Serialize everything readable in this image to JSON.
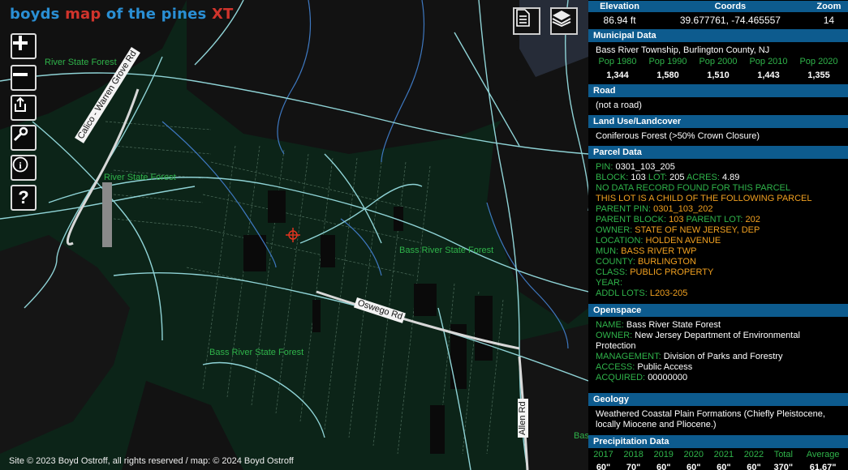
{
  "brand": {
    "part1": "boyds ",
    "part2": "map",
    "part3": " of the pines ",
    "part4": "XT"
  },
  "map": {
    "labels": [
      "River State Forest",
      "River State Forest",
      "Bass River State Forest",
      "Bass River State Forest",
      "Bas"
    ],
    "roads": {
      "calico": "Calico - Warren Grove Rd",
      "oswego": "Oswego Rd",
      "allen": "Allen Rd"
    },
    "controls": [
      "zoom-in-icon",
      "zoom-out-icon",
      "share-icon",
      "wrench-icon",
      "info-icon",
      "help-icon"
    ],
    "help_glyph": "?",
    "info_glyph": "i",
    "top_buttons": [
      "document-icon",
      "layers-icon"
    ]
  },
  "footer": {
    "text": "Site © 2023 Boyd Ostroff, all rights reserved / map: © 2024 Boyd Ostroff"
  },
  "panel": {
    "top": {
      "headers": [
        "Elevation",
        "Coords",
        "Zoom"
      ],
      "values": [
        "86.94 ft",
        "39.677761, -74.465557",
        "14"
      ]
    },
    "municipal": {
      "title": "Municipal Data",
      "place": "Bass River Township, Burlington County, NJ",
      "pop_headers": [
        "Pop 1980",
        "Pop 1990",
        "Pop 2000",
        "Pop 2010",
        "Pop 2020"
      ],
      "pop_values": [
        "1,344",
        "1,580",
        "1,510",
        "1,443",
        "1,355"
      ]
    },
    "road": {
      "title": "Road",
      "value": "(not a road)"
    },
    "landuse": {
      "title": "Land Use/Landcover",
      "value": "Coniferous Forest (>50% Crown Closure)"
    },
    "parcel": {
      "title": "Parcel Data",
      "pin_label": "PIN:",
      "pin": "0301_103_205",
      "block_label": "BLOCK:",
      "block": "103",
      "lot_label": "LOT:",
      "lot": "205",
      "acres_label": "ACRES:",
      "acres": "4.89",
      "no_record": "NO DATA RECORD FOUND FOR THIS PARCEL",
      "child": "THIS LOT IS A CHILD OF THE FOLLOWING PARCEL",
      "parent_pin_label": "PARENT PIN:",
      "parent_pin": "0301_103_202",
      "parent_block_label": "PARENT BLOCK:",
      "parent_block": "103",
      "parent_lot_label": "PARENT LOT:",
      "parent_lot": "202",
      "owner_label": "OWNER:",
      "owner": "STATE OF NEW JERSEY, DEP",
      "location_label": "LOCATION:",
      "location": "HOLDEN AVENUE",
      "mun_label": "MUN:",
      "mun": "BASS RIVER TWP",
      "county_label": "COUNTY:",
      "county": "BURLINGTON",
      "class_label": "CLASS:",
      "class": "PUBLIC PROPERTY",
      "year_label": "YEAR:",
      "addl_label": "ADDL LOTS:",
      "addl": "L203-205"
    },
    "openspace": {
      "title": "Openspace",
      "name_label": "NAME:",
      "name": "Bass River State Forest",
      "owner_label": "OWNER:",
      "owner": "New Jersey Department of Environmental Protection",
      "mgmt_label": "MANAGEMENT:",
      "mgmt": "Division of Parks and Forestry",
      "access_label": "ACCESS:",
      "access": "Public Access",
      "acquired_label": "ACQUIRED:",
      "acquired": "00000000"
    },
    "geology": {
      "title": "Geology",
      "value": "Weathered Coastal Plain Formations (Chiefly Pleistocene, locally Miocene and Pliocene.)"
    },
    "precip": {
      "title": "Precipitation Data",
      "headers": [
        "2017",
        "2018",
        "2019",
        "2020",
        "2021",
        "2022",
        "Total",
        "Average"
      ],
      "values": [
        "60\"",
        "70\"",
        "60\"",
        "60\"",
        "60\"",
        "60\"",
        "370\"",
        "61.67\""
      ]
    }
  },
  "colors": {
    "accent": "#0d5b8e",
    "green_label": "#2fb34a",
    "orange_value": "#f0a020",
    "forest": "#0c2418",
    "road": "#8fd3d6"
  }
}
